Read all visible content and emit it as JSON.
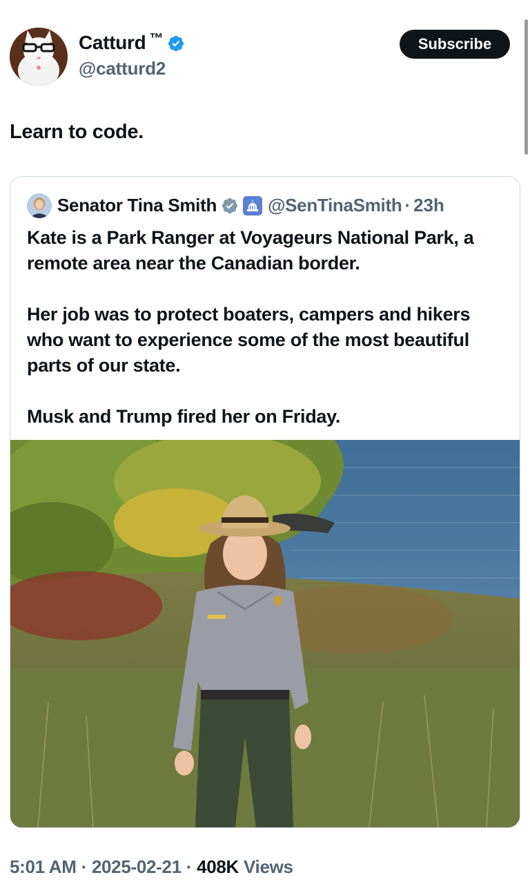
{
  "author": {
    "name": "Catturd",
    "tm": "™",
    "handle": "@catturd2",
    "avatar_icon": "cat-with-glasses-avatar"
  },
  "subscribe_label": "Subscribe",
  "tweet_text": "Learn to code.",
  "quote": {
    "name": "Senator Tina Smith",
    "handle": "@SenTinaSmith",
    "separator": "·",
    "time": "23h",
    "paragraphs": [
      "Kate is a Park Ranger at Voyageurs National Park, a remote area near the Canadian border.",
      "Her job was to protect boaters, campers and hikers who want to experience some of the most beautiful parts of our state.",
      "Musk and Trump fired her on Friday."
    ],
    "badges": [
      "gray-verified-icon",
      "capitol-affiliation-icon"
    ]
  },
  "meta": {
    "time": "5:01 AM",
    "sep1": " · ",
    "date": "2025-02-21",
    "sep2": " · ",
    "views_count": "408K",
    "views_label": " Views"
  },
  "colors": {
    "verified_blue": "#1d9bf0",
    "text_primary": "#0f1419",
    "text_secondary": "#536471",
    "border": "#cfd9de"
  }
}
